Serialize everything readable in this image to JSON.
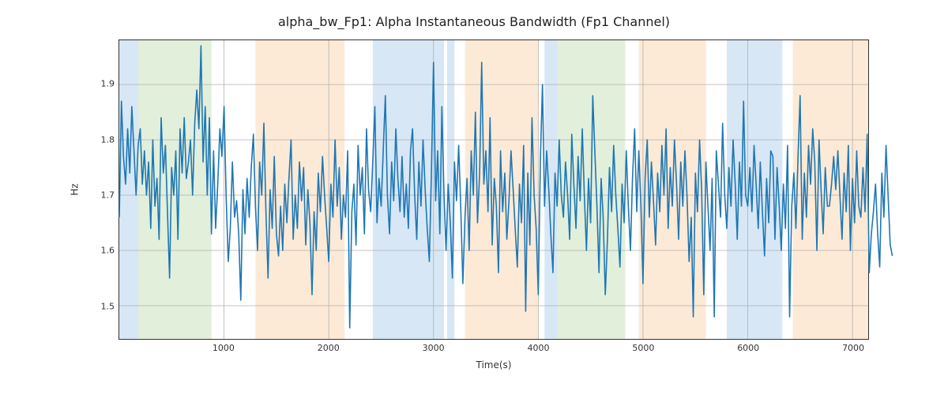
{
  "chart_data": {
    "type": "line",
    "title": "alpha_bw_Fp1: Alpha Instantaneous Bandwidth (Fp1 Channel)",
    "xlabel": "Time(s)",
    "ylabel": "Hz",
    "xlim": [
      0,
      7150
    ],
    "ylim": [
      1.44,
      1.98
    ],
    "xticks": [
      1000,
      2000,
      3000,
      4000,
      5000,
      6000,
      7000
    ],
    "yticks": [
      1.5,
      1.6,
      1.7,
      1.8,
      1.9
    ],
    "bands": [
      {
        "start": 0,
        "end": 180,
        "class": "blue"
      },
      {
        "start": 180,
        "end": 880,
        "class": "green"
      },
      {
        "start": 1300,
        "end": 2150,
        "class": "orange"
      },
      {
        "start": 2420,
        "end": 3100,
        "class": "blue"
      },
      {
        "start": 3130,
        "end": 3200,
        "class": "blue"
      },
      {
        "start": 3300,
        "end": 4000,
        "class": "orange"
      },
      {
        "start": 4060,
        "end": 4180,
        "class": "blue"
      },
      {
        "start": 4180,
        "end": 4830,
        "class": "green"
      },
      {
        "start": 4960,
        "end": 5600,
        "class": "orange"
      },
      {
        "start": 5800,
        "end": 6330,
        "class": "blue"
      },
      {
        "start": 6430,
        "end": 7150,
        "class": "orange"
      }
    ],
    "series": [
      {
        "name": "alpha_bw_Fp1",
        "x_step": 20,
        "values": [
          1.66,
          1.87,
          1.77,
          1.72,
          1.82,
          1.74,
          1.86,
          1.78,
          1.7,
          1.79,
          1.82,
          1.72,
          1.78,
          1.7,
          1.76,
          1.64,
          1.8,
          1.68,
          1.73,
          1.62,
          1.84,
          1.74,
          1.79,
          1.67,
          1.55,
          1.75,
          1.7,
          1.78,
          1.62,
          1.82,
          1.74,
          1.84,
          1.73,
          1.76,
          1.8,
          1.7,
          1.83,
          1.89,
          1.82,
          1.97,
          1.76,
          1.86,
          1.7,
          1.84,
          1.63,
          1.78,
          1.64,
          1.72,
          1.82,
          1.77,
          1.86,
          1.7,
          1.58,
          1.64,
          1.76,
          1.66,
          1.69,
          1.63,
          1.51,
          1.71,
          1.63,
          1.73,
          1.66,
          1.75,
          1.81,
          1.68,
          1.6,
          1.76,
          1.7,
          1.83,
          1.67,
          1.55,
          1.71,
          1.64,
          1.77,
          1.63,
          1.59,
          1.68,
          1.6,
          1.72,
          1.65,
          1.73,
          1.8,
          1.62,
          1.7,
          1.64,
          1.76,
          1.69,
          1.75,
          1.61,
          1.71,
          1.65,
          1.52,
          1.67,
          1.6,
          1.74,
          1.67,
          1.77,
          1.7,
          1.64,
          1.58,
          1.72,
          1.66,
          1.8,
          1.68,
          1.75,
          1.62,
          1.7,
          1.66,
          1.78,
          1.46,
          1.67,
          1.72,
          1.61,
          1.79,
          1.7,
          1.75,
          1.63,
          1.82,
          1.71,
          1.67,
          1.76,
          1.86,
          1.65,
          1.73,
          1.68,
          1.78,
          1.88,
          1.7,
          1.63,
          1.76,
          1.69,
          1.82,
          1.73,
          1.67,
          1.77,
          1.66,
          1.72,
          1.64,
          1.78,
          1.82,
          1.7,
          1.62,
          1.76,
          1.68,
          1.8,
          1.71,
          1.64,
          1.58,
          1.74,
          1.94,
          1.69,
          1.78,
          1.63,
          1.86,
          1.7,
          1.6,
          1.72,
          1.65,
          1.55,
          1.76,
          1.69,
          1.79,
          1.68,
          1.54,
          1.66,
          1.73,
          1.6,
          1.78,
          1.7,
          1.85,
          1.65,
          1.74,
          1.94,
          1.72,
          1.78,
          1.67,
          1.84,
          1.61,
          1.73,
          1.68,
          1.56,
          1.78,
          1.67,
          1.74,
          1.62,
          1.69,
          1.78,
          1.71,
          1.64,
          1.57,
          1.72,
          1.65,
          1.79,
          1.49,
          1.74,
          1.61,
          1.84,
          1.7,
          1.64,
          1.52,
          1.76,
          1.9,
          1.68,
          1.78,
          1.71,
          1.63,
          1.56,
          1.74,
          1.68,
          1.8,
          1.7,
          1.66,
          1.76,
          1.7,
          1.62,
          1.81,
          1.72,
          1.64,
          1.77,
          1.69,
          1.82,
          1.7,
          1.6,
          1.73,
          1.65,
          1.88,
          1.78,
          1.68,
          1.56,
          1.73,
          1.66,
          1.52,
          1.62,
          1.75,
          1.67,
          1.79,
          1.7,
          1.64,
          1.57,
          1.72,
          1.65,
          1.78,
          1.68,
          1.6,
          1.73,
          1.82,
          1.67,
          1.78,
          1.68,
          1.54,
          1.73,
          1.8,
          1.66,
          1.76,
          1.69,
          1.61,
          1.74,
          1.67,
          1.79,
          1.7,
          1.82,
          1.64,
          1.75,
          1.68,
          1.8,
          1.72,
          1.62,
          1.76,
          1.68,
          1.78,
          1.7,
          1.58,
          1.66,
          1.48,
          1.74,
          1.67,
          1.8,
          1.71,
          1.52,
          1.76,
          1.68,
          1.6,
          1.73,
          1.48,
          1.78,
          1.72,
          1.66,
          1.83,
          1.7,
          1.64,
          1.75,
          1.68,
          1.8,
          1.72,
          1.62,
          1.76,
          1.68,
          1.87,
          1.7,
          1.68,
          1.75,
          1.67,
          1.79,
          1.72,
          1.64,
          1.76,
          1.67,
          1.59,
          1.73,
          1.65,
          1.78,
          1.77,
          1.62,
          1.75,
          1.68,
          1.6,
          1.72,
          1.64,
          1.79,
          1.48,
          1.68,
          1.74,
          1.64,
          1.77,
          1.88,
          1.62,
          1.74,
          1.66,
          1.79,
          1.72,
          1.82,
          1.76,
          1.6,
          1.8,
          1.71,
          1.63,
          1.75,
          1.68,
          1.68,
          1.72,
          1.77,
          1.71,
          1.78,
          1.7,
          1.62,
          1.74,
          1.67,
          1.79,
          1.6,
          1.73,
          1.65,
          1.78,
          1.68,
          1.66,
          1.75,
          1.67,
          1.81,
          1.56,
          1.63,
          1.67,
          1.72,
          1.63,
          1.57,
          1.74,
          1.66,
          1.79,
          1.7,
          1.61,
          1.59
        ]
      }
    ]
  }
}
